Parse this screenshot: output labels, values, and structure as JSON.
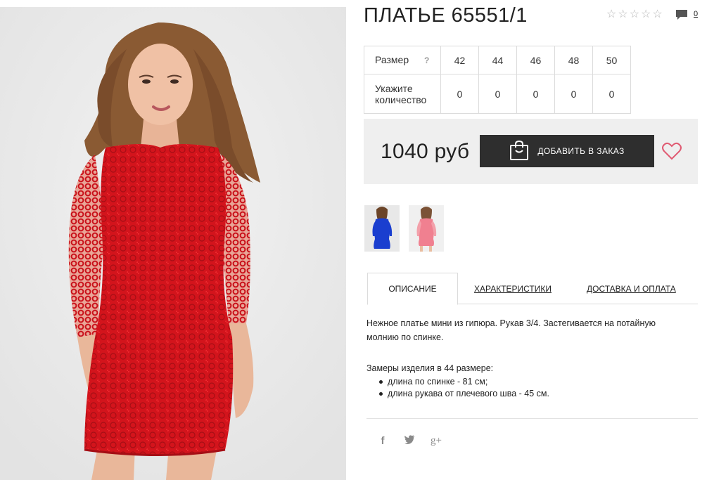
{
  "product": {
    "title": "ПЛАТЬЕ 65551/1",
    "rating_stars": 0,
    "comment_count": "0"
  },
  "size_table": {
    "size_label": "Размер",
    "help": "?",
    "sizes": [
      "42",
      "44",
      "46",
      "48",
      "50"
    ],
    "qty_label": "Укажите количество",
    "quantities": [
      "0",
      "0",
      "0",
      "0",
      "0"
    ]
  },
  "buy": {
    "price": "1040 руб",
    "add_button": "ДОБАВИТЬ В ЗАКАЗ"
  },
  "thumbnails": [
    {
      "name": "blue-dress",
      "color": "#1a3ecf"
    },
    {
      "name": "pink-dress",
      "color": "#f08090"
    }
  ],
  "tabs": [
    {
      "label": "ОПИСАНИЕ",
      "active": true
    },
    {
      "label": "ХАРАКТЕРИСТИКИ",
      "active": false
    },
    {
      "label": "ДОСТАВКА И ОПЛАТА",
      "active": false
    }
  ],
  "description": {
    "text": "Нежное платье мини из гипюра. Рукав 3/4. Застегивается на потайную молнию по спинке.",
    "measurements_title": "Замеры изделия в 44 размере:",
    "measurements": [
      "длина по спинке - 81 см;",
      "длина рукава от плечевого шва - 45 см."
    ]
  },
  "social": {
    "facebook": "f",
    "twitter": "t",
    "google_plus": "g+"
  },
  "colors": {
    "dress": "#d4141c",
    "button": "#2e2e2e",
    "heart": "#e05a72",
    "star": "#b9b9b9"
  }
}
